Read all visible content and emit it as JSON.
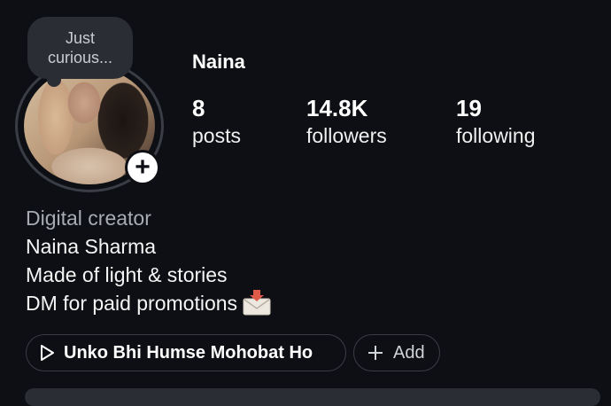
{
  "profile": {
    "username": "Naina",
    "note": "Just curious...",
    "stats": [
      {
        "value": "8",
        "label": "posts"
      },
      {
        "value": "14.8K",
        "label": "followers"
      },
      {
        "value": "19",
        "label": "following"
      }
    ],
    "bio": {
      "category": "Digital creator",
      "name": "Naina Sharma",
      "line1": "Made of light & stories",
      "line2": "DM for paid promotions"
    },
    "music_chip": {
      "label": "Unko Bhi Humse Mohobat Ho",
      "icon": "play-icon"
    },
    "add_chip": {
      "label": "Add",
      "icon": "plus-icon"
    }
  },
  "colors": {
    "background": "#0d0f14",
    "chip_border": "#3a3d45",
    "note_bg": "#2a2d33"
  }
}
